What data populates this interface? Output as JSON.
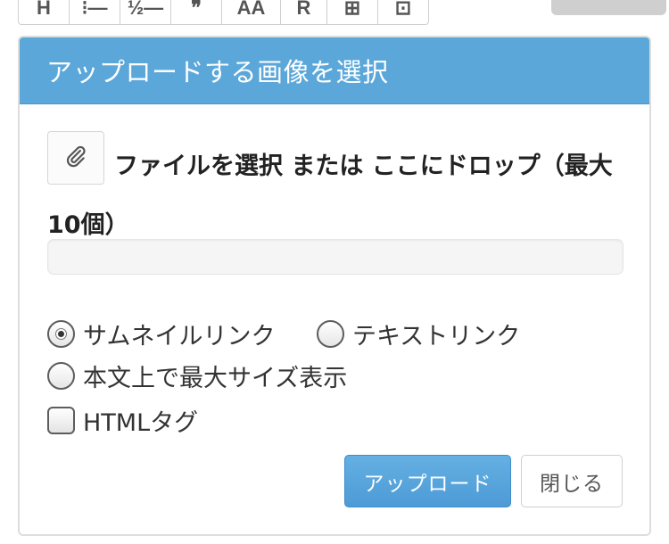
{
  "toolbar": {
    "items": [
      {
        "icon": "header-icon",
        "glyph": "H"
      },
      {
        "icon": "bullet-list-icon",
        "glyph": "⁝—"
      },
      {
        "icon": "numbered-list-icon",
        "glyph": "½—"
      },
      {
        "icon": "quote-icon",
        "glyph": "❞"
      },
      {
        "icon": "font-size-icon",
        "glyph": "AA"
      },
      {
        "icon": "ruby-icon",
        "glyph": "R"
      },
      {
        "icon": "table-icon",
        "glyph": "⊞"
      },
      {
        "icon": "embed-icon",
        "glyph": "⊡"
      }
    ]
  },
  "dialog": {
    "title": "アップロードする画像を選択",
    "file_prompt": "ファイルを選択 または ここにドロップ（最大10個）",
    "progress": 0,
    "link_options": {
      "thumbnail": "サムネイルリンク",
      "text": "テキストリンク",
      "fullsize": "本文上で最大サイズ表示",
      "selected": "サムネイルリンク"
    },
    "html_tag_label": "HTMLタグ",
    "html_tag_checked": false,
    "upload_button": "アップロード",
    "close_button": "閉じる"
  },
  "colors": {
    "header": "#5ba7d9",
    "primary_button": "#5ba7d9"
  }
}
